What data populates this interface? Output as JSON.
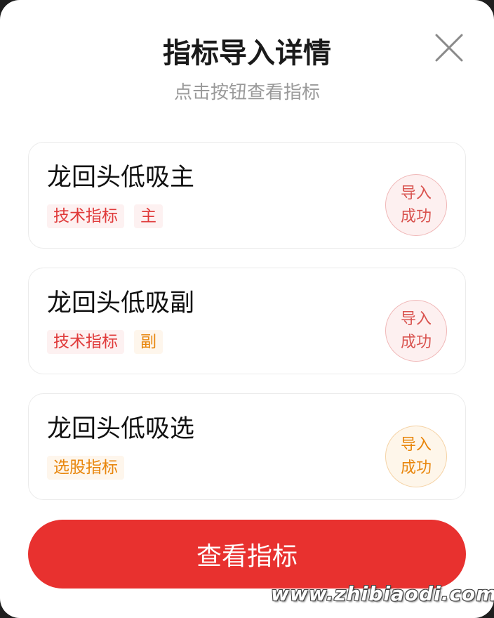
{
  "dialog": {
    "title": "指标导入详情",
    "subtitle": "点击按钮查看指标",
    "close_icon": "close-icon"
  },
  "cards": [
    {
      "name": "龙回头低吸主",
      "tags": [
        {
          "label": "技术指标",
          "color": "#e03a3a",
          "bg": "#fdf1f1"
        },
        {
          "label": "主",
          "color": "#e03a3a",
          "bg": "#fdf1f1"
        }
      ],
      "badge": {
        "line1": "导入",
        "line2": "成功",
        "color": "#d9534f",
        "bg": "#fdf0f0",
        "border": "#f0b8b8"
      }
    },
    {
      "name": "龙回头低吸副",
      "tags": [
        {
          "label": "技术指标",
          "color": "#e03a3a",
          "bg": "#fdf1f1"
        },
        {
          "label": "副",
          "color": "#e8860c",
          "bg": "#fef6ec"
        }
      ],
      "badge": {
        "line1": "导入",
        "line2": "成功",
        "color": "#d9534f",
        "bg": "#fdf0f0",
        "border": "#f0b8b8"
      }
    },
    {
      "name": "龙回头低吸选",
      "tags": [
        {
          "label": "选股指标",
          "color": "#e8860c",
          "bg": "#fef6ec"
        }
      ],
      "badge": {
        "line1": "导入",
        "line2": "成功",
        "color": "#e8860c",
        "bg": "#fef6ea",
        "border": "#f5d3a6"
      }
    }
  ],
  "cta": {
    "label": "查看指标",
    "color": "#e8312f"
  },
  "watermark": "www.zhibiaodi.com"
}
